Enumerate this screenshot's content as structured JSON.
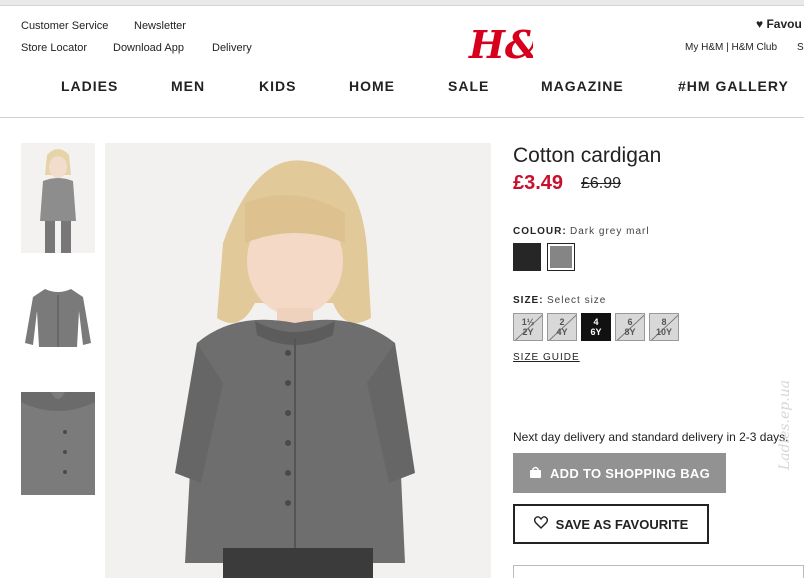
{
  "header": {
    "utility_left": [
      "Customer Service",
      "Newsletter",
      "Store Locator",
      "Download App",
      "Delivery"
    ],
    "favourites_label": "Favou",
    "account_links": "My H&M | H&M Club",
    "account_extra": "S",
    "logo_text": "H&M"
  },
  "nav": {
    "items": [
      "LADIES",
      "MEN",
      "KIDS",
      "HOME",
      "SALE",
      "MAGAZINE",
      "#HM GALLERY"
    ]
  },
  "product": {
    "title": "Cotton cardigan",
    "price": "£3.49",
    "old_price": "£6.99",
    "colour_label": "COLOUR:",
    "colour_value": "Dark grey marl",
    "size_label": "SIZE:",
    "size_value": "Select size",
    "sizes": [
      {
        "line1": "1½",
        "line2": "2Y",
        "available": false
      },
      {
        "line1": "2",
        "line2": "4Y",
        "available": false
      },
      {
        "line1": "4",
        "line2": "6Y",
        "available": true
      },
      {
        "line1": "6",
        "line2": "8Y",
        "available": false
      },
      {
        "line1": "8",
        "line2": "10Y",
        "available": false
      }
    ],
    "size_guide": "SIZE GUIDE",
    "delivery_text": "Next day delivery and standard delivery in 2-3 days.",
    "add_to_bag": "ADD TO SHOPPING BAG",
    "save_favourite": "SAVE AS FAVOURITE",
    "swatch_colors": [
      "#262626",
      "#858585"
    ]
  },
  "colors": {
    "brand_red": "#d6001c",
    "price_red": "#c8102e",
    "bag_button": "#929292"
  },
  "icons": {
    "heart": "heart-icon",
    "bag": "shopping-bag-icon",
    "heart_outline": "heart-outline-icon"
  },
  "watermark": "Ladies.ep.ua"
}
